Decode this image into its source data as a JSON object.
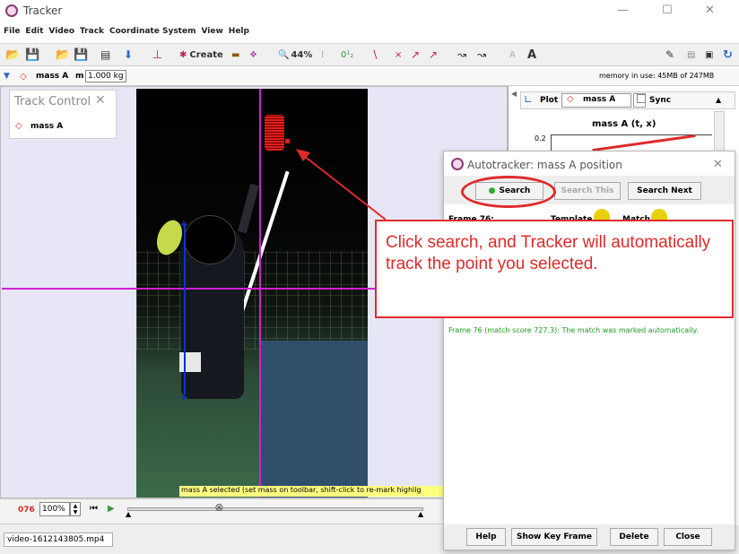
{
  "app": {
    "title": "Tracker"
  },
  "window_controls": {
    "minimize": "—",
    "maximize": "☐",
    "close": "✕"
  },
  "menu": [
    "File",
    "Edit",
    "Video",
    "Track",
    "Coordinate System",
    "View",
    "Help"
  ],
  "toolbar": {
    "create_label": "Create",
    "zoom": "44%",
    "step_label": "0¹₂"
  },
  "trackbar": {
    "track_name": "mass A",
    "mass_prefix": "m",
    "mass_value": "1.000 kg",
    "memory": "memory in use: 45MB of 247MB"
  },
  "track_control": {
    "title": "Track Control",
    "item": "mass A"
  },
  "plot": {
    "tab_label": "Plot",
    "track": "mass A",
    "sync_label": "Sync",
    "title": "mass A (t, x)",
    "y_tick": "0.2"
  },
  "video": {
    "point_label": "mass A",
    "status_message": "mass A selected (set mass on toolbar, shift-click to re-mark highlig"
  },
  "playback": {
    "frame": "076",
    "speed": "100%"
  },
  "file_tab": "video-1612143805.mp4",
  "autotracker": {
    "title": "Autotracker: mass A position",
    "buttons": {
      "search": "Search",
      "search_this": "Search This",
      "search_next": "Search Next"
    },
    "frame_label": "Frame 76:",
    "template_label": "Template",
    "match_label": "Match",
    "log": "Frame 76 (match score 727.3): The match was marked automatically.",
    "footer": {
      "help": "Help",
      "show_key_frame": "Show Key Frame",
      "delete": "Delete",
      "close": "Close"
    }
  },
  "annotation": {
    "text": "Click search, and Tracker will automatically track the point you selected."
  },
  "colors": {
    "accent": "#e02a2a",
    "axis_line": "#d21fd2",
    "track": "#e0201a",
    "status_yellow": "#ffff80"
  }
}
